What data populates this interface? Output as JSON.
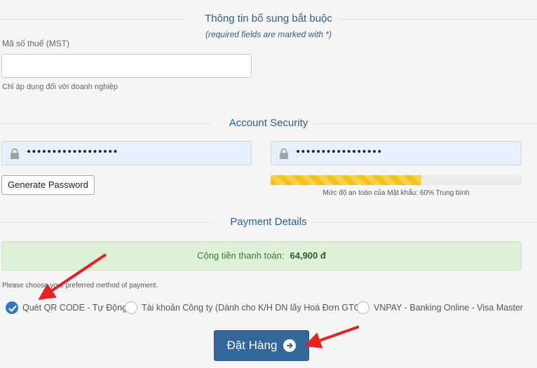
{
  "required_section": {
    "title": "Thông tin bổ sung bắt buộc",
    "note": "(required fields are marked with *)",
    "tax_label": "Mã số thuế (MST)",
    "tax_value": "",
    "tax_help": "Chỉ áp dụng đối với doanh nghiệp"
  },
  "account_security": {
    "title": "Account Security",
    "password_dots": "••••••••••••••••••",
    "confirm_dots": "•••••••••••••••••",
    "generate_label": "Generate Password",
    "strength_percent": 60,
    "strength_text": "Mức độ an toàn của Mật khẩu: 60% Trung bình"
  },
  "payment": {
    "title": "Payment Details",
    "total_label": "Cộng tiền thanh toán:",
    "total_value": "64,900 đ",
    "hint": "Please choose your preferred method of payment.",
    "methods": [
      {
        "label": "Quét QR CODE - Tự Động",
        "checked": true
      },
      {
        "label": "Tài khoản Công ty (Dành cho K/H DN lấy Hoá Đơn GTGT)",
        "checked": false
      },
      {
        "label": "VNPAY - Banking Online - Visa Master",
        "checked": false
      }
    ],
    "order_label": "Đặt Hàng"
  },
  "colors": {
    "accent": "#336699",
    "section_title": "#2e5f88",
    "success_bg": "#dff0d8",
    "annotation_red": "#e8201e"
  },
  "icons": {
    "password_field": "lock-icon",
    "order_button": "arrow-circle-right-icon",
    "selected_radio": "check-icon"
  }
}
